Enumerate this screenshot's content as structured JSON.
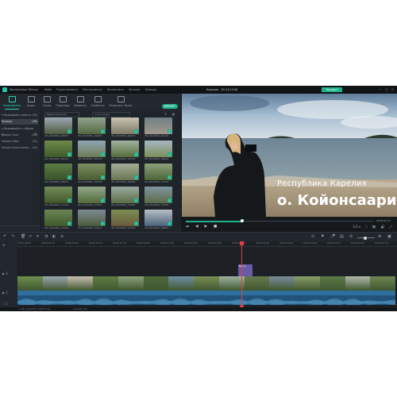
{
  "app": {
    "name": "Wondershare Filmora",
    "menu": [
      "Файл",
      "Редактировать",
      "Инструменты",
      "Посмотреть",
      "Экспорт",
      "Помощь"
    ],
    "project_title": "Карелия - 00:13:23:08",
    "export_label": "Экспорт",
    "window_controls": [
      "—",
      "□",
      "✕"
    ]
  },
  "tabs": [
    {
      "label": "Медиафайлы",
      "icon": "media-icon",
      "active": true
    },
    {
      "label": "Аудио",
      "icon": "audio-icon"
    },
    {
      "label": "Титры",
      "icon": "titles-icon"
    },
    {
      "label": "Переходы",
      "icon": "transitions-icon"
    },
    {
      "label": "Эффекты",
      "icon": "effects-icon"
    },
    {
      "label": "Элементы",
      "icon": "elements-icon"
    },
    {
      "label": "Разделить Экран",
      "icon": "split-screen-icon"
    }
  ],
  "import_label": "ИМПОРТ",
  "left_panel": {
    "items": [
      {
        "label": "▾ Медиафайл проекта",
        "count": "(95)"
      },
      {
        "label": "Каталог",
        "count": "(95)",
        "selected": true
      },
      {
        "label": "▸ Медиафайлы с общим д...",
        "count": "(0)"
      },
      {
        "label": "Sample Color",
        "count": "(25)"
      },
      {
        "label": "Sample Video",
        "count": "(20)"
      },
      {
        "label": "Sample Green Screen",
        "count": "(10)"
      }
    ]
  },
  "media": {
    "filter_label": "Медиа проекта ▾",
    "search_placeholder": "Поиск медиа",
    "thumbs": [
      {
        "name": "VID_20210801_155927",
        "colors": [
          "#9aa7b1",
          "#4f5a3f"
        ]
      },
      {
        "name": "VID_20210801_154855",
        "colors": [
          "#8fa28d",
          "#56683f"
        ]
      },
      {
        "name": "VID_20210801_161015",
        "colors": [
          "#c9c2b0",
          "#7d7a66"
        ]
      },
      {
        "name": "VID_20210801_161101",
        "colors": [
          "#6f7f86",
          "#a1998a"
        ]
      },
      {
        "name": "VID_20210801_162410",
        "colors": [
          "#6f8a4a",
          "#3e5a2c"
        ]
      },
      {
        "name": "VID_20210801_162702",
        "colors": [
          "#8fa6b4",
          "#6e7b55"
        ]
      },
      {
        "name": "VID_20210801_163345",
        "colors": [
          "#9fb3a0",
          "#566b3a"
        ]
      },
      {
        "name": "VID_20210801_164034",
        "colors": [
          "#a6b7c2",
          "#7d8d5a"
        ]
      },
      {
        "name": "VID_20210801_165013",
        "colors": [
          "#5d7d45",
          "#38502a"
        ]
      },
      {
        "name": "VID_20210801_165208",
        "colors": [
          "#7c8f62",
          "#495b30"
        ]
      },
      {
        "name": "VID_20210801_165906",
        "colors": [
          "#a2ad98",
          "#6b7450"
        ]
      },
      {
        "name": "VID_20210801_170133",
        "colors": [
          "#8aa17a",
          "#4c6434"
        ]
      },
      {
        "name": "VID_20210801_171246",
        "colors": [
          "#748c5c",
          "#3f5627"
        ]
      },
      {
        "name": "VID_20210801_172023",
        "colors": [
          "#92a78b",
          "#516a3a"
        ]
      },
      {
        "name": "VID_20210801_172845",
        "colors": [
          "#9aa9a0",
          "#5c6d46"
        ]
      },
      {
        "name": "VID_20210801_173539",
        "colors": [
          "#8095a0",
          "#5c6a48"
        ]
      },
      {
        "name": "VID_20210801_174400",
        "colors": [
          "#6d8454",
          "#405a2b"
        ]
      },
      {
        "name": "VID_20210801_175021",
        "colors": [
          "#7d8c96",
          "#4a5a3a"
        ]
      },
      {
        "name": "VID_20210801_175510",
        "colors": [
          "#7b8e54",
          "#6b5a3a"
        ]
      },
      {
        "name": "VID_20210801_180010",
        "colors": [
          "#b7c0c6",
          "#4a607a"
        ]
      }
    ]
  },
  "preview": {
    "caption_line1": "Республика Карелия",
    "caption_line2": "о. Койонсаари",
    "progress": 0.3,
    "timecode": "00:00:07:17",
    "controls": [
      "⏮",
      "◀",
      "▶",
      "■"
    ],
    "right_controls": [
      "1/2 ▾",
      "⛶",
      "📷",
      "🔊",
      "⤢"
    ]
  },
  "timeline": {
    "ruler_ticks": [
      "00:00:00:00",
      "00:00:01:25",
      "00:00:03:20",
      "00:00:05:15",
      "00:00:07:10",
      "00:00:09:05",
      "00:00:11:00",
      "00:00:12:25",
      "00:00:14:20",
      "00:00:16:15",
      "00:00:18:10",
      "00:00:20:05",
      "00:00:22:00",
      "00:00:23:25",
      "00:00:25:20",
      "00:00:27:15"
    ],
    "title_clip_label": "Basic 6",
    "bottom_left": "≡ VID_20210801_155927.mp4",
    "bottom_right": "Cassette.mp4",
    "clip_colors": [
      "#6b8f4f",
      "#9aa7b1",
      "#c7c0b0",
      "#5f7c44",
      "#8aa17a",
      "#4f6a3a",
      "#6f8fa4",
      "#7b8e54",
      "#9fb3a0",
      "#667a4c",
      "#7a8d9a",
      "#8a9f6a",
      "#5c7a48",
      "#b0b8a8",
      "#6f8753"
    ]
  }
}
